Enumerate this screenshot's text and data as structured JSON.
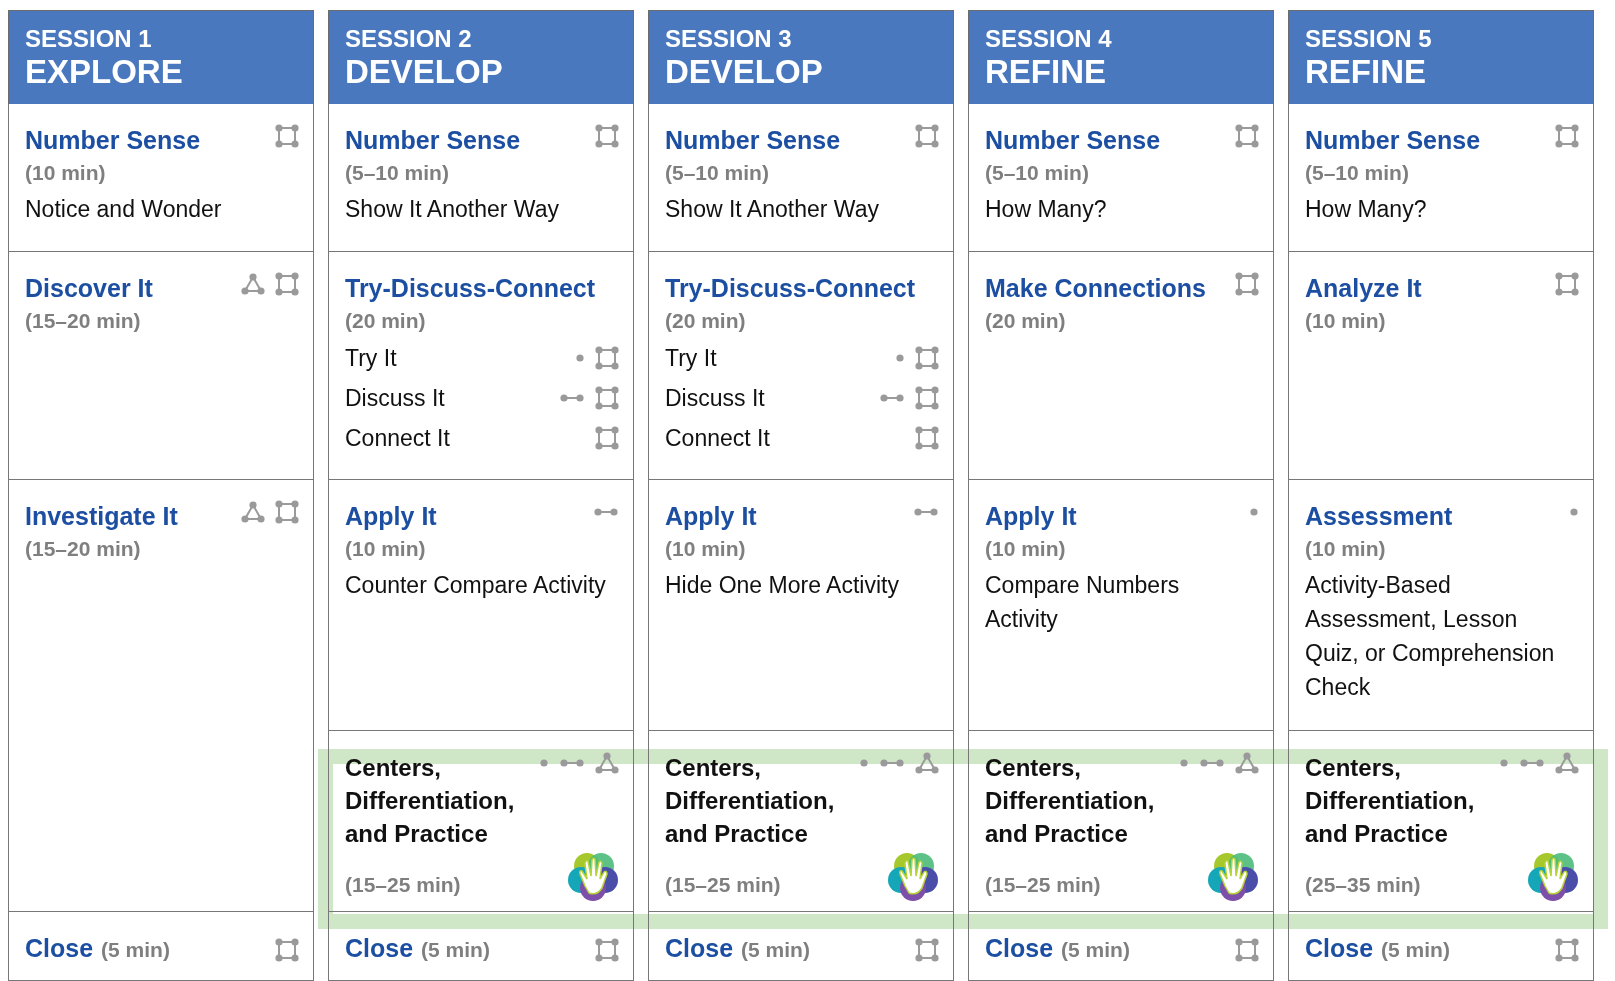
{
  "sessions": [
    {
      "number": "SESSION 1",
      "phase": "EXPLORE",
      "blocks": [
        {
          "kind": "activity",
          "title": "Number Sense",
          "duration": "(10 min)",
          "icons": [
            {
              "kind": "square"
            }
          ],
          "description": "Notice and Wonder"
        },
        {
          "kind": "activity",
          "title": "Discover It",
          "duration": "(15–20 min)",
          "icons": [
            {
              "kind": "triangle"
            },
            {
              "kind": "square"
            }
          ]
        },
        {
          "kind": "activity",
          "title": "Investigate It",
          "duration": "(15–20 min)",
          "icons": [
            {
              "kind": "triangle"
            },
            {
              "kind": "square"
            }
          ]
        },
        {
          "kind": "close",
          "title": "Close",
          "duration": "(5 min)",
          "icons": [
            {
              "kind": "square"
            }
          ]
        }
      ]
    },
    {
      "number": "SESSION 2",
      "phase": "DEVELOP",
      "blocks": [
        {
          "kind": "activity",
          "title": "Number Sense",
          "duration": "(5–10 min)",
          "icons": [
            {
              "kind": "square"
            }
          ],
          "description": "Show It Another Way"
        },
        {
          "kind": "activity",
          "title": "Try-Discuss-Connect",
          "duration": "(20 min)",
          "items": [
            {
              "text": "Try It",
              "icons": [
                {
                  "kind": "dot"
                },
                {
                  "kind": "square"
                }
              ]
            },
            {
              "text": "Discuss It",
              "icons": [
                {
                  "kind": "pair"
                },
                {
                  "kind": "square"
                }
              ]
            },
            {
              "text": "Connect It",
              "icons": [
                {
                  "kind": "square"
                }
              ]
            }
          ]
        },
        {
          "kind": "activity",
          "title": "Apply It",
          "duration": "(10 min)",
          "icons": [
            {
              "kind": "pair"
            }
          ],
          "description": "Counter Compare Activity"
        },
        {
          "kind": "centers",
          "title": "Centers, Differentiation, and Practice",
          "duration": "(15–25 min)",
          "icons": [
            {
              "kind": "dot"
            },
            {
              "kind": "pair"
            },
            {
              "kind": "triangle"
            }
          ],
          "highlighted": true
        },
        {
          "kind": "close",
          "title": "Close",
          "duration": "(5 min)",
          "icons": [
            {
              "kind": "square"
            }
          ]
        }
      ]
    },
    {
      "number": "SESSION 3",
      "phase": "DEVELOP",
      "blocks": [
        {
          "kind": "activity",
          "title": "Number Sense",
          "duration": "(5–10 min)",
          "icons": [
            {
              "kind": "square"
            }
          ],
          "description": "Show It Another Way"
        },
        {
          "kind": "activity",
          "title": "Try-Discuss-Connect",
          "duration": "(20 min)",
          "items": [
            {
              "text": "Try It",
              "icons": [
                {
                  "kind": "dot"
                },
                {
                  "kind": "square"
                }
              ]
            },
            {
              "text": "Discuss It",
              "icons": [
                {
                  "kind": "pair"
                },
                {
                  "kind": "square"
                }
              ]
            },
            {
              "text": "Connect It",
              "icons": [
                {
                  "kind": "square"
                }
              ]
            }
          ]
        },
        {
          "kind": "activity",
          "title": "Apply It",
          "duration": "(10 min)",
          "icons": [
            {
              "kind": "pair"
            }
          ],
          "description": "Hide One More Activity"
        },
        {
          "kind": "centers",
          "title": "Centers, Differentiation, and Practice",
          "duration": "(15–25 min)",
          "icons": [
            {
              "kind": "dot"
            },
            {
              "kind": "pair"
            },
            {
              "kind": "triangle"
            }
          ],
          "highlighted": true
        },
        {
          "kind": "close",
          "title": "Close",
          "duration": "(5 min)",
          "icons": [
            {
              "kind": "square"
            }
          ]
        }
      ]
    },
    {
      "number": "SESSION 4",
      "phase": "REFINE",
      "blocks": [
        {
          "kind": "activity",
          "title": "Number Sense",
          "duration": "(5–10 min)",
          "icons": [
            {
              "kind": "square"
            }
          ],
          "description": "How Many?"
        },
        {
          "kind": "activity",
          "title": "Make Connections",
          "duration": "(20 min)",
          "icons": [
            {
              "kind": "square"
            }
          ]
        },
        {
          "kind": "activity",
          "title": "Apply It",
          "duration": "(10 min)",
          "icons": [
            {
              "kind": "dot"
            }
          ],
          "description": "Compare Numbers Activity"
        },
        {
          "kind": "centers",
          "title": "Centers, Differentiation, and Practice",
          "duration": "(15–25 min)",
          "icons": [
            {
              "kind": "dot"
            },
            {
              "kind": "pair"
            },
            {
              "kind": "triangle"
            }
          ],
          "highlighted": true
        },
        {
          "kind": "close",
          "title": "Close",
          "duration": "(5 min)",
          "icons": [
            {
              "kind": "square"
            }
          ]
        }
      ]
    },
    {
      "number": "SESSION 5",
      "phase": "REFINE",
      "blocks": [
        {
          "kind": "activity",
          "title": "Number Sense",
          "duration": "(5–10 min)",
          "icons": [
            {
              "kind": "square"
            }
          ],
          "description": "How Many?"
        },
        {
          "kind": "activity",
          "title": "Analyze It",
          "duration": "(10 min)",
          "icons": [
            {
              "kind": "square"
            }
          ]
        },
        {
          "kind": "activity",
          "title": "Assessment",
          "duration": "(10 min)",
          "icons": [
            {
              "kind": "dot"
            }
          ],
          "description": "Activity-Based Assessment, Lesson Quiz, or Comprehension Check"
        },
        {
          "kind": "centers",
          "title": "Centers, Differentiation, and Practice",
          "duration": "(25–35 min)",
          "icons": [
            {
              "kind": "dot"
            },
            {
              "kind": "pair"
            },
            {
              "kind": "triangle"
            }
          ],
          "highlighted": true
        },
        {
          "kind": "close",
          "title": "Close",
          "duration": "(5 min)",
          "icons": [
            {
              "kind": "square"
            }
          ]
        }
      ]
    }
  ]
}
